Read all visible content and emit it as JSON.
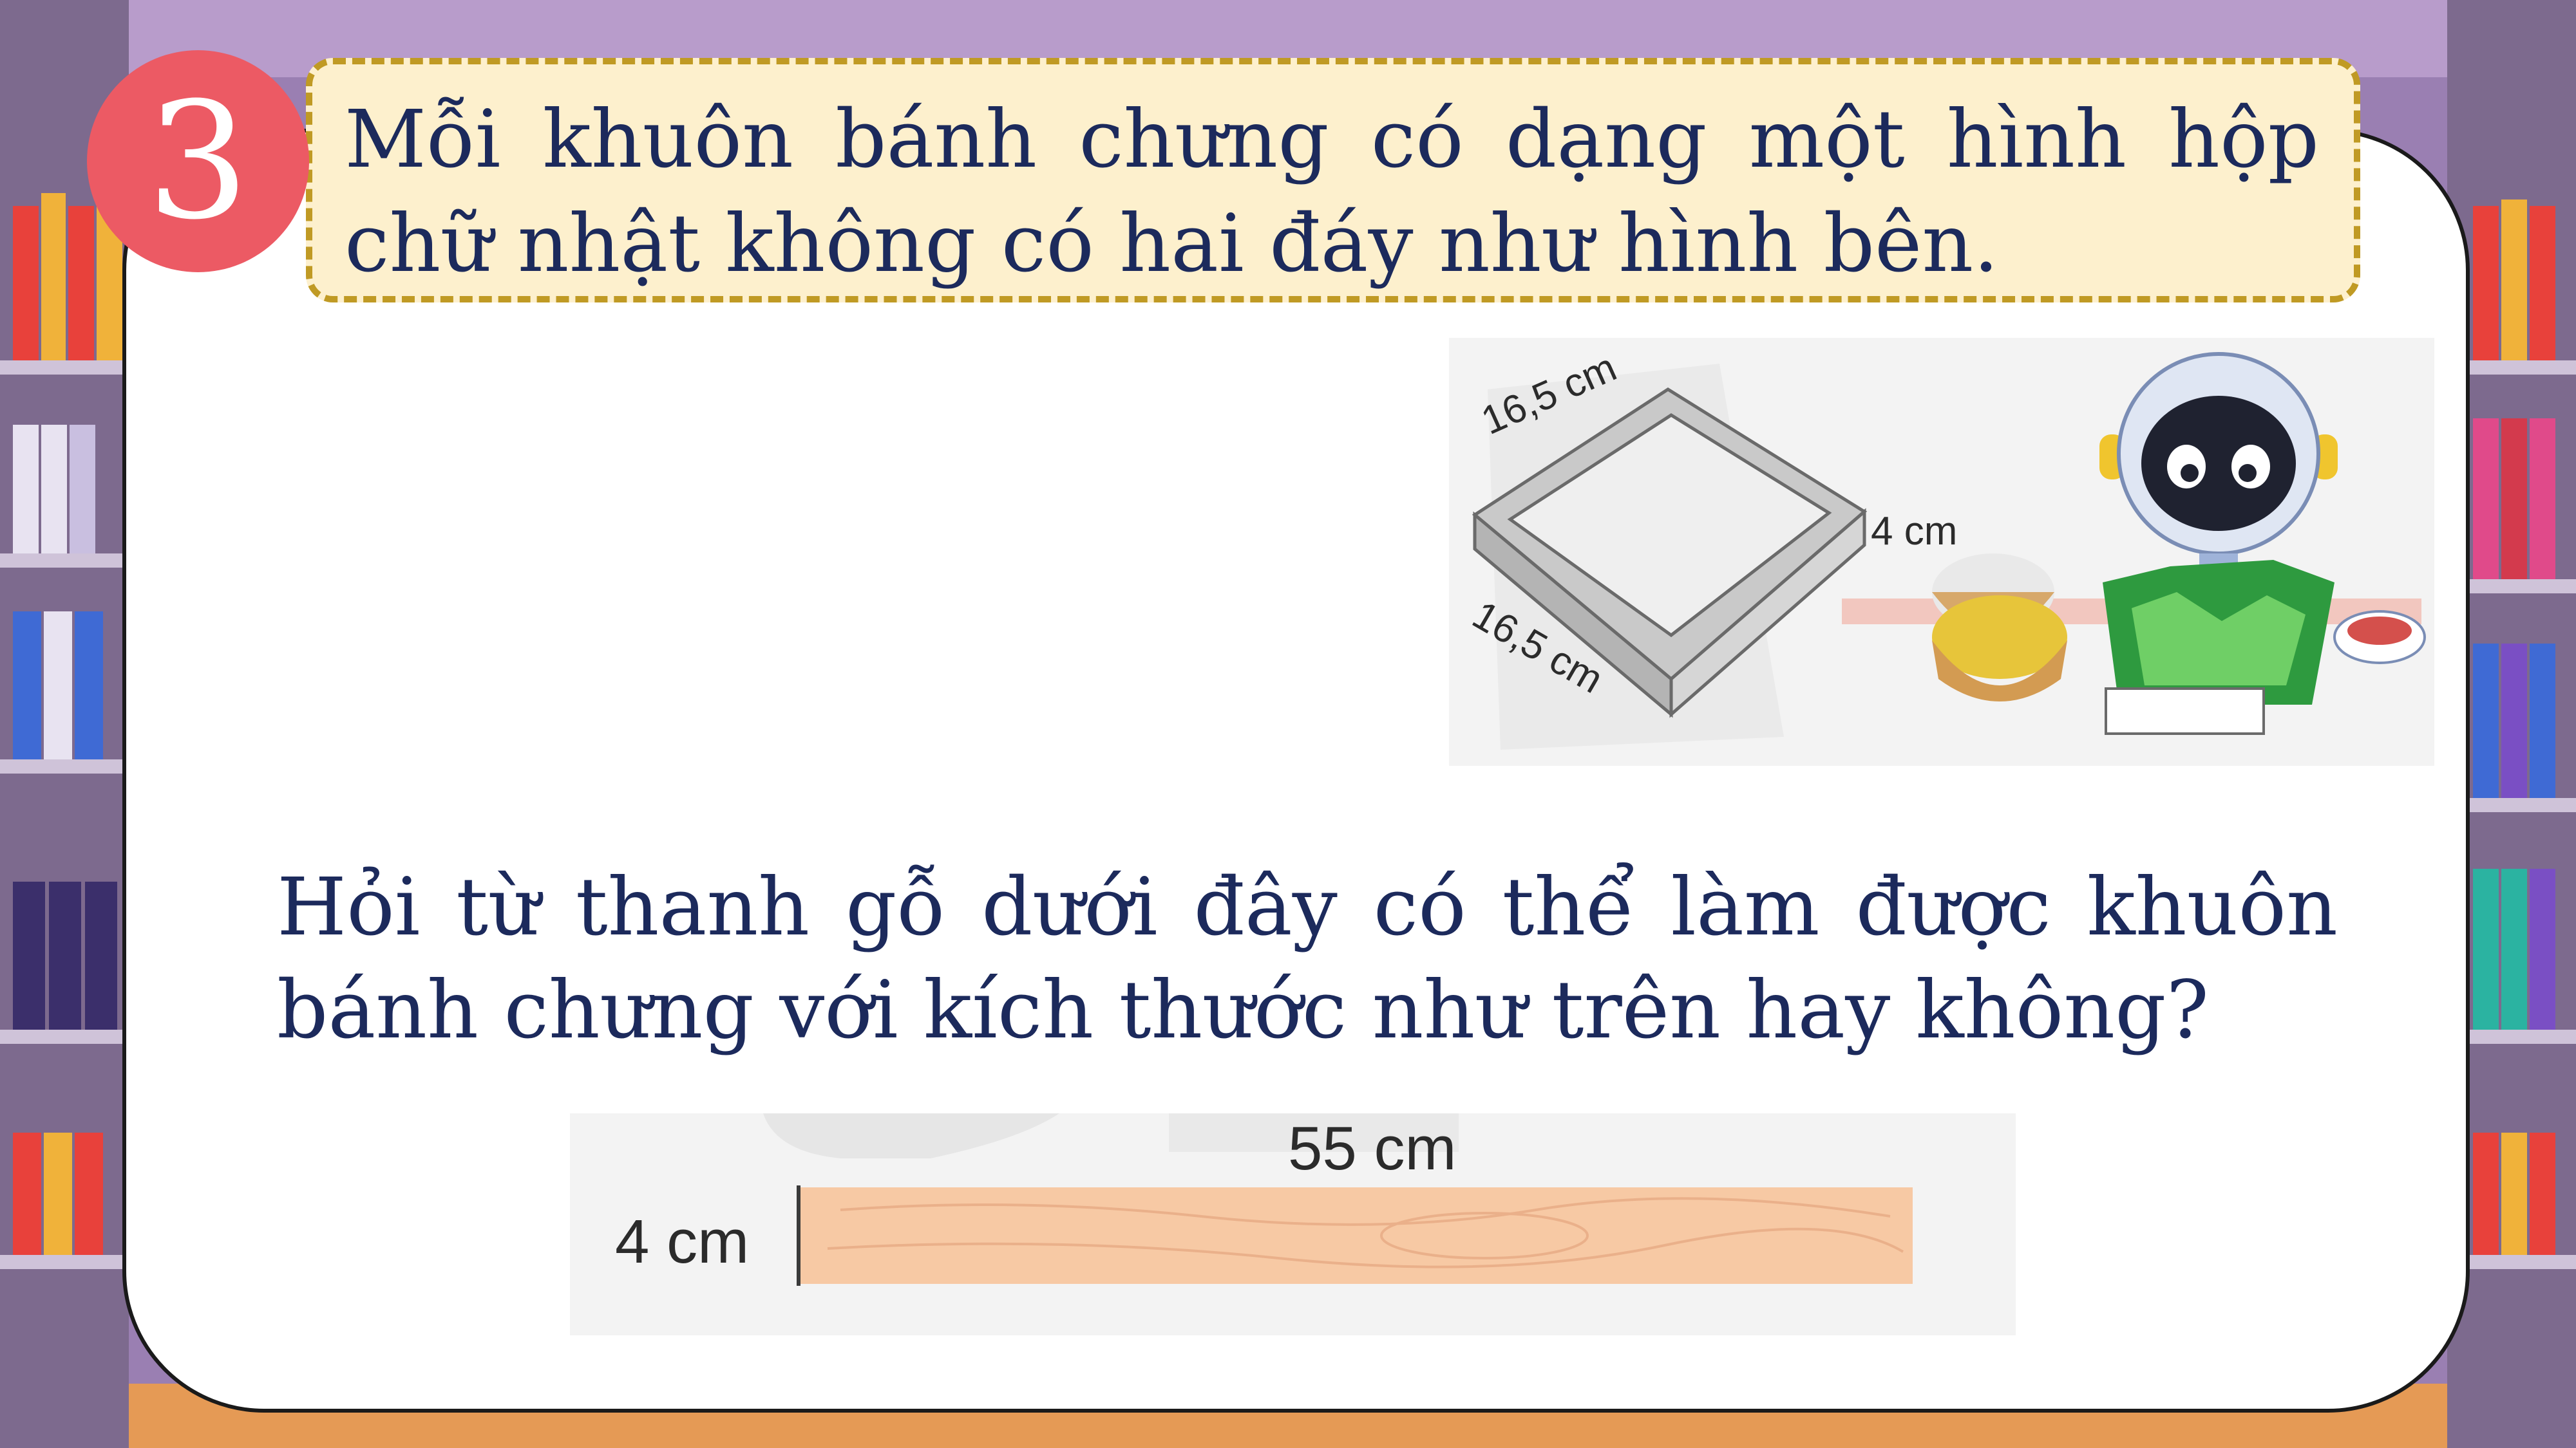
{
  "badge": {
    "number": "3"
  },
  "problem": {
    "statement": "Mỗi khuôn bánh chưng có dạng một hình hộp chữ nhật không có hai đáy như hình bên.",
    "question": "Hỏi từ thanh gỗ dưới đây có thể làm được khuôn bánh chưng với kích thước như trên hay không?"
  },
  "mould_figure": {
    "top_edge": "16,5 cm",
    "height": "4 cm",
    "bottom_edge": "16,5 cm"
  },
  "plank_figure": {
    "length": "55 cm",
    "width": "4 cm"
  },
  "colors": {
    "badge": "#ec5a64",
    "banner_fill": "#fdf0cd",
    "banner_border": "#c09a24",
    "text": "#1c2a5c",
    "wood": "#f7c9a4"
  }
}
